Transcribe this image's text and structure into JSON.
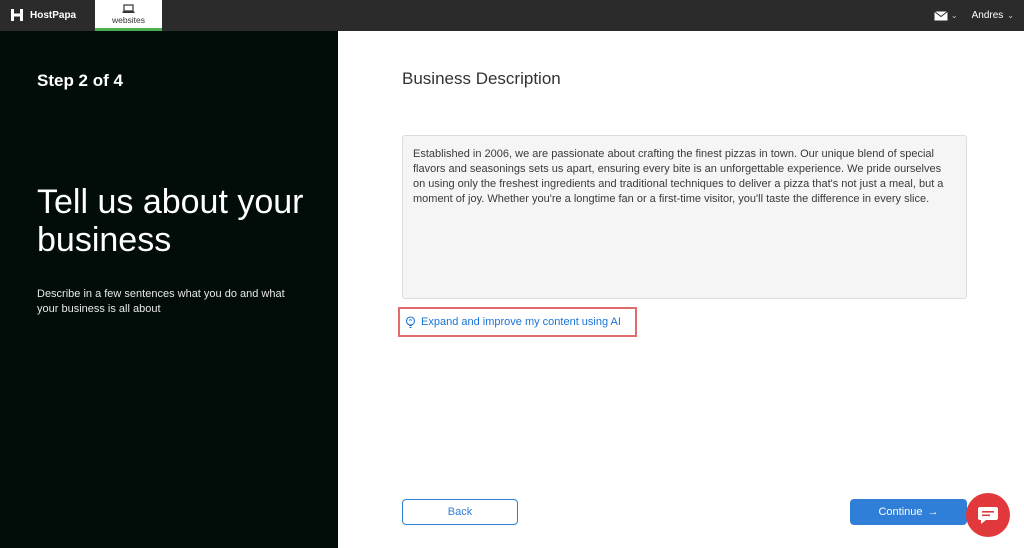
{
  "topbar": {
    "brand": "HostPapa",
    "tab_label": "websites",
    "user_name": "Andres",
    "chevron": "⌄"
  },
  "left": {
    "step": "Step 2 of 4",
    "headline": "Tell us about your business",
    "subtext": "Describe in a few sentences what you do and what your business is all about"
  },
  "main": {
    "title": "Business Description",
    "description": "Established in 2006, we are passionate about crafting the finest pizzas in town. Our unique blend of special flavors and seasonings sets us apart, ensuring every bite is an unforgettable experience. We pride ourselves on using only the freshest ingredients and traditional techniques to deliver a pizza that's not just a meal, but a moment of joy. Whether you're a longtime fan or a first-time visitor, you'll taste the difference in every slice.",
    "ai_link": "Expand and improve my content using AI"
  },
  "footer": {
    "back_label": "Back",
    "continue_label": "Continue",
    "continue_arrow": "→"
  },
  "icons": {
    "logo": "hostpapa-logo-icon",
    "tab": "laptop-icon",
    "mail": "envelope-icon",
    "ai": "lightbulb-icon",
    "chat": "chat-bubble-icon"
  },
  "colors": {
    "accent": "#2f7ed8",
    "left_panel": "#020c08",
    "highlight": "#e06c6f",
    "chat": "#e0383b",
    "tab_indicator": "#4caf50"
  }
}
